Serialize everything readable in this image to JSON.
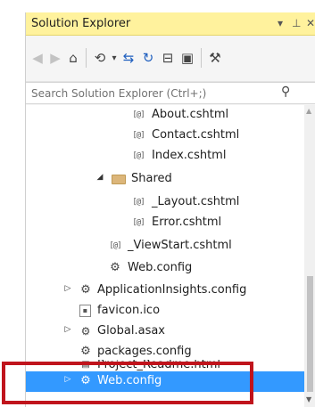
{
  "window": {
    "title": "Solution Explorer",
    "title_dropdown_glyph": "▾",
    "title_pin_glyph": "⊥",
    "title_close_glyph": "✕"
  },
  "toolbar": {
    "back_glyph": "◀",
    "forward_glyph": "▶",
    "home_glyph": "⌂",
    "history_glyph": "⟲",
    "history_dropdown_glyph": "▾",
    "sync_glyph": "⇆",
    "refresh_glyph": "↻",
    "collapse_glyph": "⊟",
    "show_all_glyph": "▣",
    "properties_glyph": "⚒"
  },
  "search": {
    "placeholder": "Search Solution Explorer (Ctrl+;)",
    "icon_glyph": "⚲"
  },
  "tree": {
    "items": [
      {
        "label": "About.cshtml",
        "icon": "cshtml-icon",
        "icon_text": "[@]"
      },
      {
        "label": "Contact.cshtml",
        "icon": "cshtml-icon",
        "icon_text": "[@]"
      },
      {
        "label": "Index.cshtml",
        "icon": "cshtml-icon",
        "icon_text": "[@]"
      },
      {
        "label": "Shared",
        "icon": "folder-icon",
        "expander": "◢"
      },
      {
        "label": "_Layout.cshtml",
        "icon": "cshtml-icon",
        "icon_text": "[@]"
      },
      {
        "label": "Error.cshtml",
        "icon": "cshtml-icon",
        "icon_text": "[@]"
      },
      {
        "label": "_ViewStart.cshtml",
        "icon": "cshtml-icon",
        "icon_text": "[@]"
      },
      {
        "label": "Web.config",
        "icon": "config-icon",
        "icon_text": "⚙"
      },
      {
        "label": "ApplicationInsights.config",
        "icon": "config-icon",
        "icon_text": "⚙",
        "expander": "▷"
      },
      {
        "label": "favicon.ico",
        "icon": "favicon-icon",
        "icon_text": "▪"
      },
      {
        "label": "Global.asax",
        "icon": "asax-icon",
        "icon_text": "⚙",
        "expander": "▷"
      },
      {
        "label": "packages.config",
        "icon": "config-icon",
        "icon_text": "⚙"
      },
      {
        "label": "Project_Readme.html",
        "icon": "html-icon",
        "icon_text": "▤"
      },
      {
        "label": "Web.config",
        "icon": "config-icon",
        "icon_text": "⚙",
        "expander": "▷",
        "selected": true
      }
    ]
  },
  "scrollbar": {
    "up_glyph": "▲",
    "down_glyph": "▼"
  },
  "colors": {
    "title_bar": "#fff29d",
    "selection": "#3399ff",
    "highlight_box": "#c0141c"
  }
}
